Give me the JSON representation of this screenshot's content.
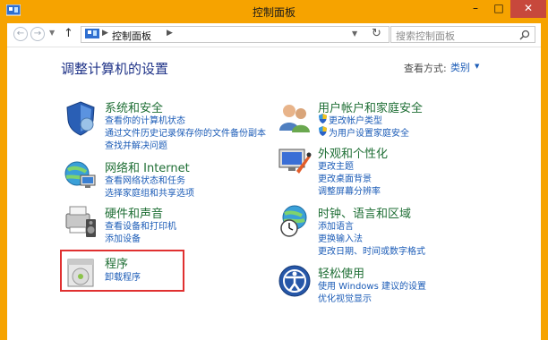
{
  "window": {
    "title": "控制面板",
    "minimize": "–",
    "maximize": "□",
    "close": "✕"
  },
  "nav": {
    "back_icon": "←",
    "forward_icon": "→",
    "up_icon": "↑",
    "address_crumb": "控制面板",
    "search_placeholder": "搜索控制面板"
  },
  "header": {
    "heading": "调整计算机的设置",
    "view_by_label": "查看方式:",
    "view_by_value": "类别"
  },
  "categories": [
    {
      "title": "系统和安全",
      "links": [
        "查看你的计算机状态",
        "通过文件历史记录保存你的文件备份副本",
        "查找并解决问题"
      ],
      "icon": "system-security-icon"
    },
    {
      "title": "网络和 Internet",
      "links": [
        "查看网络状态和任务",
        "选择家庭组和共享选项"
      ],
      "icon": "network-icon"
    },
    {
      "title": "硬件和声音",
      "links": [
        "查看设备和打印机",
        "添加设备"
      ],
      "icon": "hardware-sound-icon"
    },
    {
      "title": "程序",
      "links": [
        "卸载程序"
      ],
      "icon": "programs-icon"
    },
    {
      "title": "用户帐户和家庭安全",
      "links": [
        "更改帐户类型",
        "为用户设置家庭安全"
      ],
      "icon": "user-accounts-icon"
    },
    {
      "title": "外观和个性化",
      "links": [
        "更改主题",
        "更改桌面背景",
        "调整屏幕分辨率"
      ],
      "icon": "appearance-icon"
    },
    {
      "title": "时钟、语言和区域",
      "links": [
        "添加语言",
        "更换输入法",
        "更改日期、时间或数字格式"
      ],
      "icon": "clock-region-icon"
    },
    {
      "title": "轻松使用",
      "links": [
        "使用 Windows 建议的设置",
        "优化视觉显示"
      ],
      "icon": "ease-of-access-icon"
    }
  ],
  "colors": {
    "frame": "#f6a300",
    "close_button": "#c7483c",
    "category_title": "#1e6e34",
    "link": "#1c5cb7",
    "heading": "#1e3287",
    "highlight_box": "#e03030"
  }
}
